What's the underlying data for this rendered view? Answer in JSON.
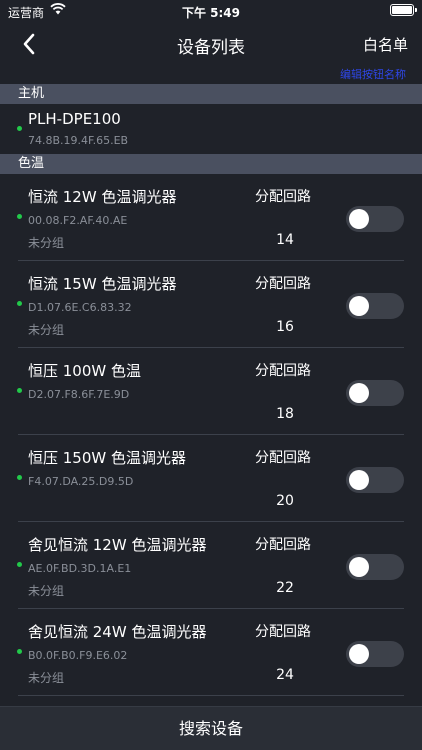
{
  "status": {
    "carrier": "运营商",
    "time": "下午 5:49"
  },
  "nav": {
    "title": "设备列表",
    "right_label": "白名单"
  },
  "edit_link": "编辑按钮名称",
  "sections": {
    "host": "主机",
    "color_temp": "色温"
  },
  "host": {
    "name": "PLH-DPE100",
    "mac": "74.8B.19.4F.65.EB"
  },
  "devices": [
    {
      "name": "恒流 12W 色温调光器",
      "mac": "00.08.F2.AF.40.AE",
      "group": "未分组",
      "loop_label": "分配回路",
      "loop_value": "14"
    },
    {
      "name": "恒流 15W 色温调光器",
      "mac": "D1.07.6E.C6.83.32",
      "group": "未分组",
      "loop_label": "分配回路",
      "loop_value": "16"
    },
    {
      "name": "恒压 100W 色温",
      "mac": "D2.07.F8.6F.7E.9D",
      "group": "",
      "loop_label": "分配回路",
      "loop_value": "18"
    },
    {
      "name": "恒压 150W 色温调光器",
      "mac": "F4.07.DA.25.D9.5D",
      "group": "",
      "loop_label": "分配回路",
      "loop_value": "20"
    },
    {
      "name": "舍见恒流 12W 色温调光器",
      "mac": "AE.0F.BD.3D.1A.E1",
      "group": "未分组",
      "loop_label": "分配回路",
      "loop_value": "22"
    },
    {
      "name": "舍见恒流 24W 色温调光器",
      "mac": "B0.0F.B0.F9.E6.02",
      "group": "未分组",
      "loop_label": "分配回路",
      "loop_value": "24"
    }
  ],
  "bottom": {
    "search_label": "搜索设备"
  },
  "colors": {
    "background": "#1f2229",
    "online_dot": "#22c94a",
    "edit_link": "#2e46e6",
    "section_header": "#4a5060"
  },
  "icons": {
    "back": "chevron-left-icon",
    "wifi": "wifi-icon",
    "battery": "battery-icon"
  }
}
